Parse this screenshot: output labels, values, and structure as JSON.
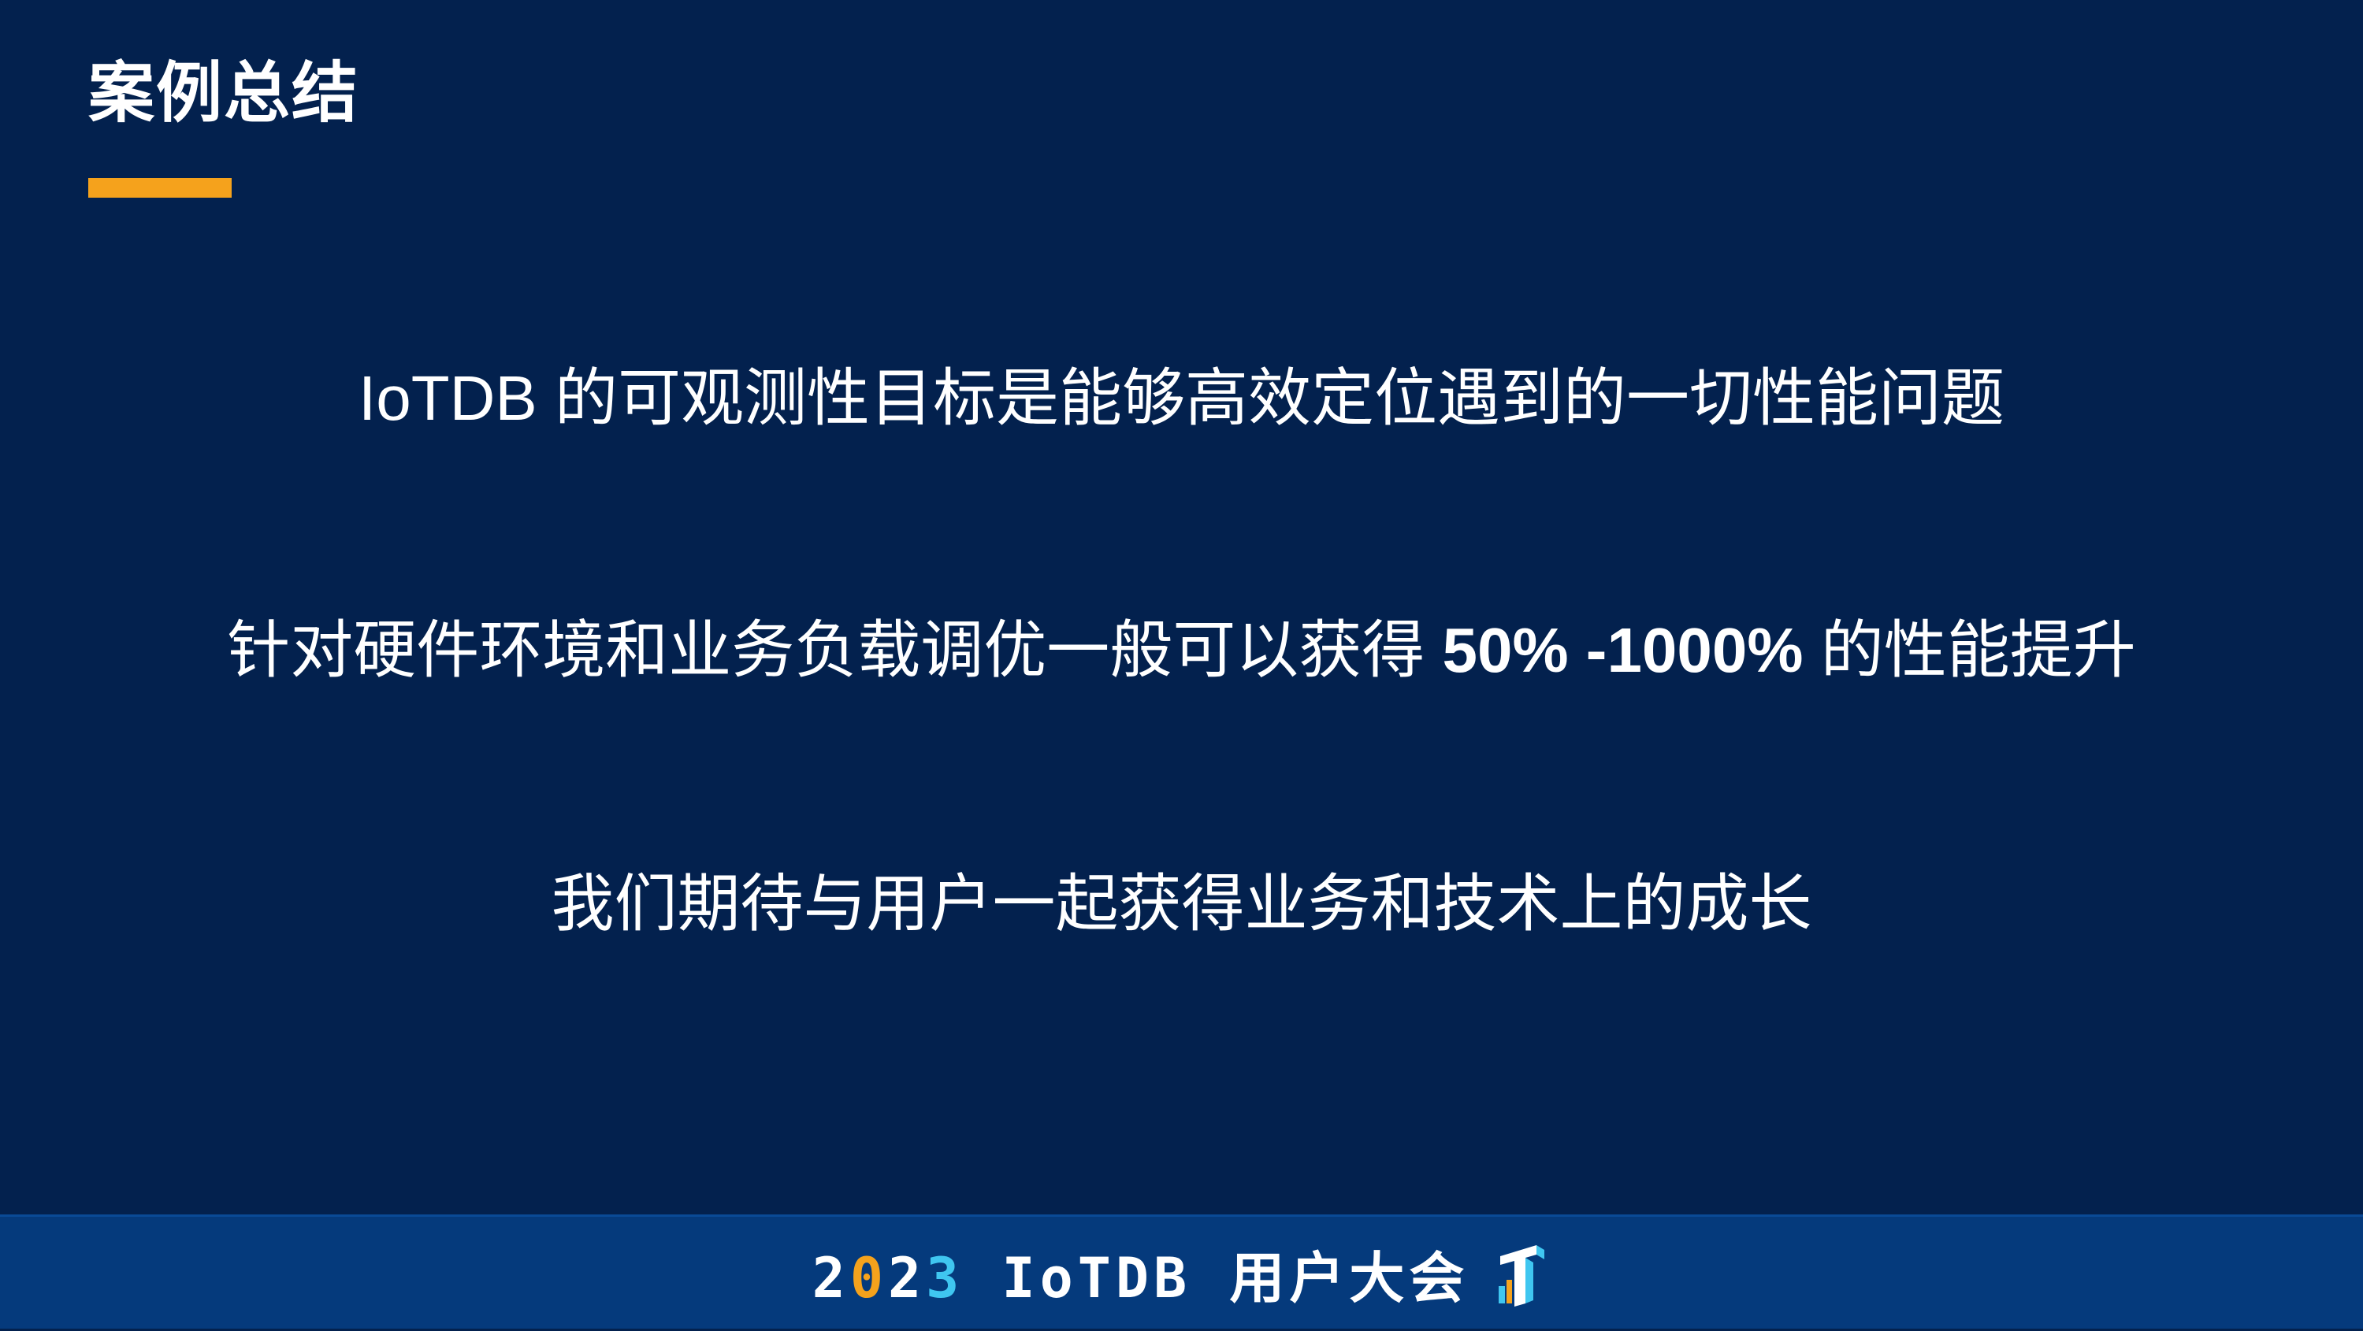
{
  "slide": {
    "title": "案例总结",
    "accent_color": "#f5a21c",
    "background_color": "#03214e",
    "lines": [
      {
        "text": "IoTDB 的可观测性目标是能够高效定位遇到的一切性能问题"
      },
      {
        "prefix": "针对硬件环境和业务负载调优一般可以获得 ",
        "highlight": "50% -1000%",
        "suffix": " 的性能提升"
      },
      {
        "text": "我们期待与用户一起获得业务和技术上的成长"
      }
    ]
  },
  "footer": {
    "year_digits": [
      "2",
      "0",
      "2",
      "3"
    ],
    "year_digit_colors": [
      "#ffffff",
      "#f5a21c",
      "#ffffff",
      "#3fc6f0"
    ],
    "event_name": "IoTDB 用户大会",
    "logo_icon": "iotdb-logo-icon",
    "background_color": "#053a7c"
  }
}
